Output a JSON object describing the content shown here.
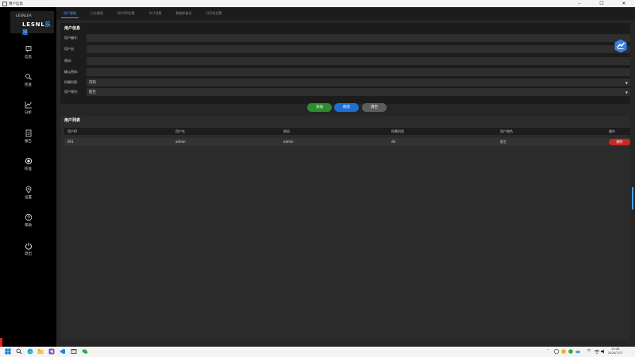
{
  "window": {
    "title": "用户信息",
    "controls": [
      "–",
      "☐",
      "✕"
    ]
  },
  "sidebar": {
    "logo_tag": "LESNLEA",
    "logo_text": "LESNL",
    "logo_cn": "乐晟",
    "items": [
      {
        "label": "信息",
        "icon": "info-icon"
      },
      {
        "label": "检查",
        "icon": "check-icon"
      },
      {
        "label": "分析",
        "icon": "analysis-icon"
      },
      {
        "label": "报告",
        "icon": "report-icon"
      },
      {
        "label": "校准",
        "icon": "calibrate-icon"
      },
      {
        "label": "设置",
        "icon": "location-icon"
      },
      {
        "label": "帮助",
        "icon": "help-icon"
      },
      {
        "label": "退出",
        "icon": "power-icon"
      }
    ],
    "accent_color": "#d22222"
  },
  "tabs": [
    {
      "label": "用户管理",
      "active": true
    },
    {
      "label": "日志管理"
    },
    {
      "label": "DICOM设置"
    },
    {
      "label": "HL7设置"
    },
    {
      "label": "数据库备份"
    },
    {
      "label": "打印机设置"
    }
  ],
  "info_section": {
    "title": "用户信息",
    "fields": [
      {
        "label": "用户编号:",
        "value": ""
      },
      {
        "label": "用户名:",
        "value": ""
      },
      {
        "label": "密码:",
        "value": ""
      },
      {
        "label": "确认密码:",
        "value": ""
      },
      {
        "label": "所属科室:",
        "value": "内科",
        "type": "select"
      },
      {
        "label": "用户角色:",
        "value": "医生",
        "type": "select"
      }
    ]
  },
  "buttons": {
    "add": "添加",
    "edit": "修改",
    "clear": "清空"
  },
  "list_section": {
    "title": "用户列表",
    "columns": [
      "用户ID",
      "用户名",
      "密码",
      "所属科室",
      "用户角色",
      "操作"
    ],
    "rows": [
      {
        "id": "001",
        "username": "admin",
        "password": "admin",
        "department": "dd",
        "role": "医生",
        "action": "删除"
      }
    ]
  },
  "taskbar": {
    "time": "15:26",
    "date": "2025/7/17",
    "lang": "中"
  },
  "colors": {
    "accent": "#4aa3ff",
    "add": "#2e8b2e",
    "edit": "#1f6fd1",
    "clear": "#5d5d5d",
    "delete": "#c62828"
  }
}
